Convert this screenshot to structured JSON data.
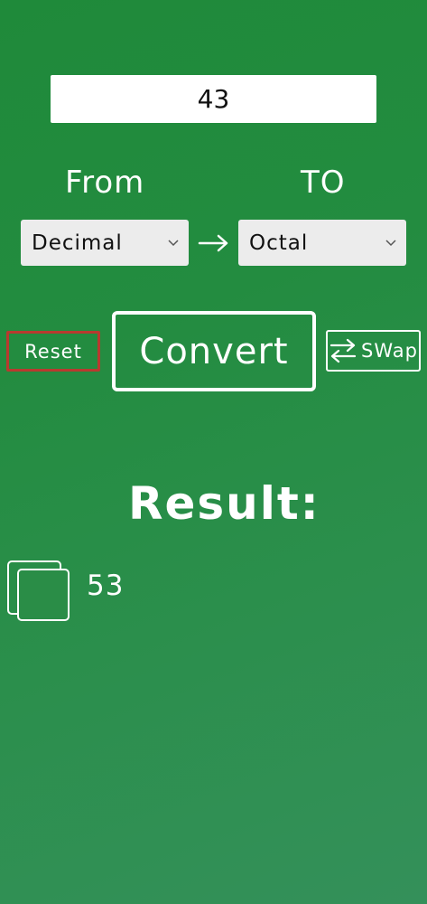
{
  "input": {
    "value": "43"
  },
  "labels": {
    "from": "From",
    "to": "TO"
  },
  "selects": {
    "from": {
      "selected": "Decimal"
    },
    "to": {
      "selected": "Octal"
    }
  },
  "buttons": {
    "reset": "Reset",
    "convert": "Convert",
    "swap": "SWap"
  },
  "result": {
    "heading": "Result:",
    "value": "53"
  },
  "colors": {
    "background": "#238c40",
    "reset_border": "#b83a2f",
    "text": "#ffffff"
  },
  "icons": {
    "arrow": "arrow-right-icon",
    "swap": "swap-arrows-icon",
    "copy": "copy-icon",
    "chevron": "chevron-down-icon"
  }
}
